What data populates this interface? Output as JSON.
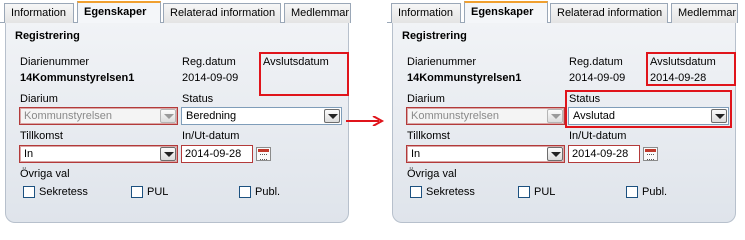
{
  "tabs": [
    "Information",
    "Egenskaper",
    "Relaterad information",
    "Medlemmar"
  ],
  "active_tab": "Egenskaper",
  "colors": {
    "highlight": "#e0141b",
    "active_tab_border": "#f0a030"
  },
  "left": {
    "section_title": "Registrering",
    "diarienummer_label": "Diarienummer",
    "diarienummer_value": "14Kommunstyrelsen1",
    "regdatum_label": "Reg.datum",
    "regdatum_value": "2014-09-09",
    "avslutsdatum_label": "Avslutsdatum",
    "avslutsdatum_value": "",
    "diarium_label": "Diarium",
    "diarium_value": "Kommunstyrelsen",
    "status_label": "Status",
    "status_value": "Beredning",
    "tillkomst_label": "Tillkomst",
    "tillkomst_value": "In",
    "inut_label": "In/Ut-datum",
    "inut_value": "2014-09-28",
    "ovriga_label": "Övriga val",
    "chk_sekretess": "Sekretess",
    "chk_pul": "PUL",
    "chk_publ": "Publ."
  },
  "right": {
    "section_title": "Registrering",
    "diarienummer_label": "Diarienummer",
    "diarienummer_value": "14Kommunstyrelsen1",
    "regdatum_label": "Reg.datum",
    "regdatum_value": "2014-09-09",
    "avslutsdatum_label": "Avslutsdatum",
    "avslutsdatum_value": "2014-09-28",
    "diarium_label": "Diarium",
    "diarium_value": "Kommunstyrelsen",
    "status_label": "Status",
    "status_value": "Avslutad",
    "tillkomst_label": "Tillkomst",
    "tillkomst_value": "In",
    "inut_label": "In/Ut-datum",
    "inut_value": "2014-09-28",
    "ovriga_label": "Övriga val",
    "chk_sekretess": "Sekretess",
    "chk_pul": "PUL",
    "chk_publ": "Publ."
  }
}
